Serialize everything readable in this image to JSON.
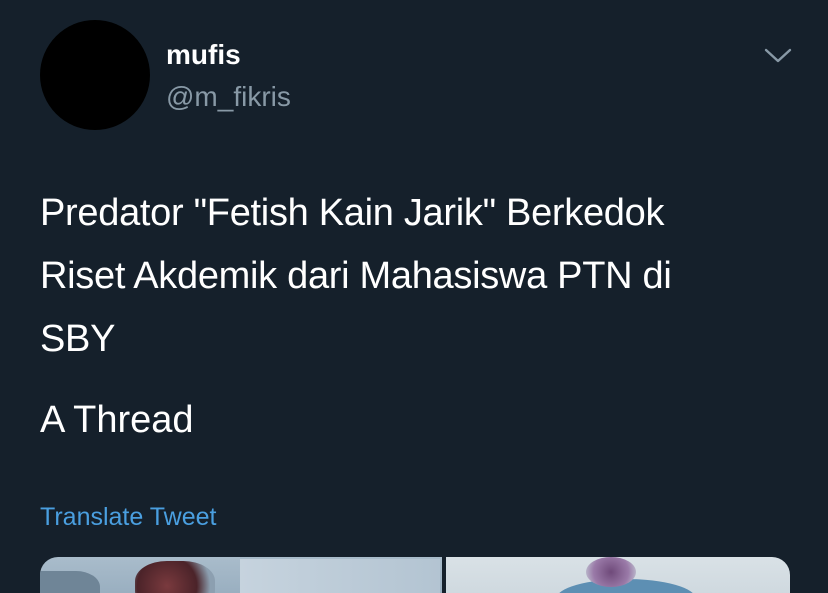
{
  "tweet": {
    "author": {
      "display_name": "mufis",
      "handle": "@m_fikris"
    },
    "text_lines": [
      "Predator \"Fetish Kain Jarik\" Berkedok",
      "Riset Akdemik dari Mahasiswa PTN di",
      "SBY"
    ],
    "thread_label": "A Thread",
    "translate_label": "Translate Tweet",
    "menu_icon": "chevron-down-icon"
  },
  "colors": {
    "background": "#15202b",
    "primary_text": "#ffffff",
    "secondary_text": "#8899a6",
    "link": "#4a9fe0"
  }
}
